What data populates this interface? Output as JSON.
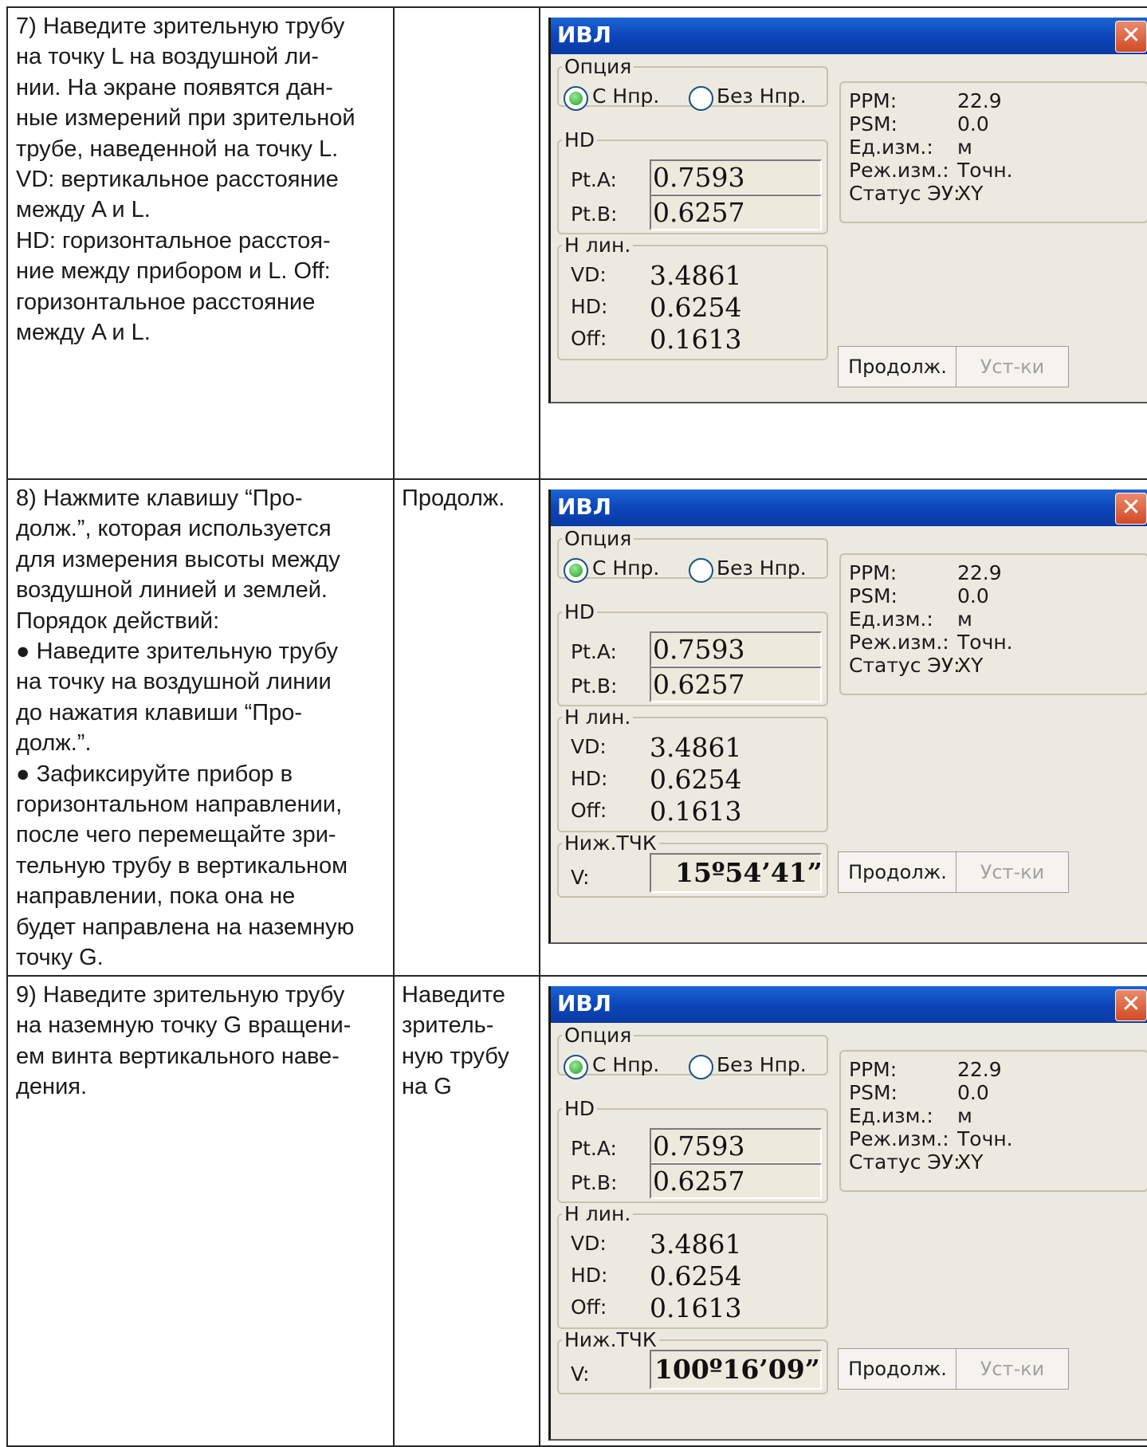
{
  "rows": [
    {
      "instruction_lines": [
        "7) Наведите зрительную трубу",
        "на точку L на воздушной ли-",
        "нии. На экране появятся дан-",
        "ные измерений при зрительной",
        "трубе, наведенной на точку L.",
        "VD: вертикальное расстояние",
        "между A и L.",
        "HD: горизонтальное расстоя-",
        "ние между прибором и L. Off:",
        "горизонтальное расстояние",
        "между A и L."
      ],
      "key": "",
      "screen": {
        "title": "ИВЛ",
        "close_icon": "✕",
        "option_group": "Опция",
        "radio_with": "С Нпр.",
        "radio_without": "Без Нпр.",
        "selected_option": "С Нпр.",
        "hd_group": "HD",
        "pta_label": "Pt.A:",
        "pta_value": "0.7593",
        "ptb_label": "Pt.B:",
        "ptb_value": "0.6257",
        "hline_group": "Н лин.",
        "vd_label": "VD:",
        "vd_value": "3.4861",
        "hd_label": "HD:",
        "hd_value": "0.6254",
        "off_label": "Off:",
        "off_value": "0.1613",
        "low_point_group": "",
        "v_label": "",
        "v_value": "",
        "info_ppm_label": "PPM:",
        "info_ppm_value": "22.9",
        "info_psm_label": "PSM:",
        "info_psm_value": "0.0",
        "info_unit_label": "Ед.изм.:",
        "info_unit_value": "м",
        "info_mode_label": "Реж.изм.:",
        "info_mode_value": "Точн.",
        "info_status_label": "Статус ЭУ:",
        "info_status_value": "XY",
        "btn_continue": "Продолж.",
        "btn_settings": "Уст-ки"
      }
    },
    {
      "instruction_lines": [
        "8) Нажмите клавишу “Про-",
        "долж.”, которая используется",
        "для измерения высоты между",
        "воздушной линией и землей.",
        "Порядок действий:",
        "● Наведите зрительную трубу",
        "на точку на воздушной линии",
        "до нажатия клавиши “Про-",
        "долж.”.",
        "● Зафиксируйте прибор в",
        "горизонтальном направлении,",
        "после чего перемещайте зри-",
        "тельную трубу в вертикальном",
        "направлении, пока она не",
        "будет направлена на наземную",
        "точку G."
      ],
      "key": "Продолж.",
      "screen": {
        "title": "ИВЛ",
        "close_icon": "✕",
        "option_group": "Опция",
        "radio_with": "С Нпр.",
        "radio_without": "Без Нпр.",
        "selected_option": "С Нпр.",
        "hd_group": "HD",
        "pta_label": "Pt.A:",
        "pta_value": "0.7593",
        "ptb_label": "Pt.B:",
        "ptb_value": "0.6257",
        "hline_group": "Н лин.",
        "vd_label": "VD:",
        "vd_value": "3.4861",
        "hd_label": "HD:",
        "hd_value": "0.6254",
        "off_label": "Off:",
        "off_value": "0.1613",
        "low_point_group": "Ниж.ТЧК",
        "v_label": "V:",
        "v_value": "15º54’41”",
        "info_ppm_label": "PPM:",
        "info_ppm_value": "22.9",
        "info_psm_label": "PSM:",
        "info_psm_value": "0.0",
        "info_unit_label": "Ед.изм.:",
        "info_unit_value": "м",
        "info_mode_label": "Реж.изм.:",
        "info_mode_value": "Точн.",
        "info_status_label": "Статус ЭУ:",
        "info_status_value": "XY",
        "btn_continue": "Продолж.",
        "btn_settings": "Уст-ки"
      }
    },
    {
      "instruction_lines": [
        "9) Наведите зрительную трубу",
        "на наземную точку G вращени-",
        "ем винта вертикального наве-",
        "дения."
      ],
      "key": "Наведите\nзритель-\nную трубу\nна G",
      "screen": {
        "title": "ИВЛ",
        "close_icon": "✕",
        "option_group": "Опция",
        "radio_with": "С Нпр.",
        "radio_without": "Без Нпр.",
        "selected_option": "С Нпр.",
        "hd_group": "HD",
        "pta_label": "Pt.A:",
        "pta_value": "0.7593",
        "ptb_label": "Pt.B:",
        "ptb_value": "0.6257",
        "hline_group": "Н лин.",
        "vd_label": "VD:",
        "vd_value": "3.4861",
        "hd_label": "HD:",
        "hd_value": "0.6254",
        "off_label": "Off:",
        "off_value": "0.1613",
        "low_point_group": "Ниж.ТЧК",
        "v_label": "V:",
        "v_value": "100º16’09”",
        "info_ppm_label": "PPM:",
        "info_ppm_value": "22.9",
        "info_psm_label": "PSM:",
        "info_psm_value": "0.0",
        "info_unit_label": "Ед.изм.:",
        "info_unit_value": "м",
        "info_mode_label": "Реж.изм.:",
        "info_mode_value": "Точн.",
        "info_status_label": "Статус ЭУ:",
        "info_status_value": "XY",
        "btn_continue": "Продолж.",
        "btn_settings": "Уст-ки"
      }
    }
  ]
}
